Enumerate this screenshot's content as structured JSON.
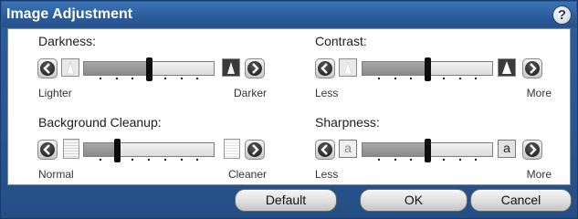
{
  "window": {
    "title": "Image Adjustment",
    "help_label": "?"
  },
  "controls": [
    {
      "label": "Darkness:",
      "min_label": "Lighter",
      "max_label": "Darker",
      "level": 0.5
    },
    {
      "label": "Contrast:",
      "min_label": "Less",
      "max_label": "More",
      "level": 0.5
    },
    {
      "label": "Background Cleanup:",
      "min_label": "Normal",
      "max_label": "Cleaner",
      "level": 0.25
    },
    {
      "label": "Sharpness:",
      "min_label": "Less",
      "max_label": "More",
      "level": 0.5
    }
  ],
  "icons": {
    "decrease": "left-arrow-icon",
    "increase": "right-arrow-icon",
    "sharpness_letter_low": "a",
    "sharpness_letter_high": "a"
  },
  "buttons": {
    "default": "Default",
    "ok": "OK",
    "cancel": "Cancel"
  },
  "colors": {
    "title_bar": "#2c5e9f",
    "frame": "#244f86",
    "slider_handle": "#0d0d0d"
  }
}
